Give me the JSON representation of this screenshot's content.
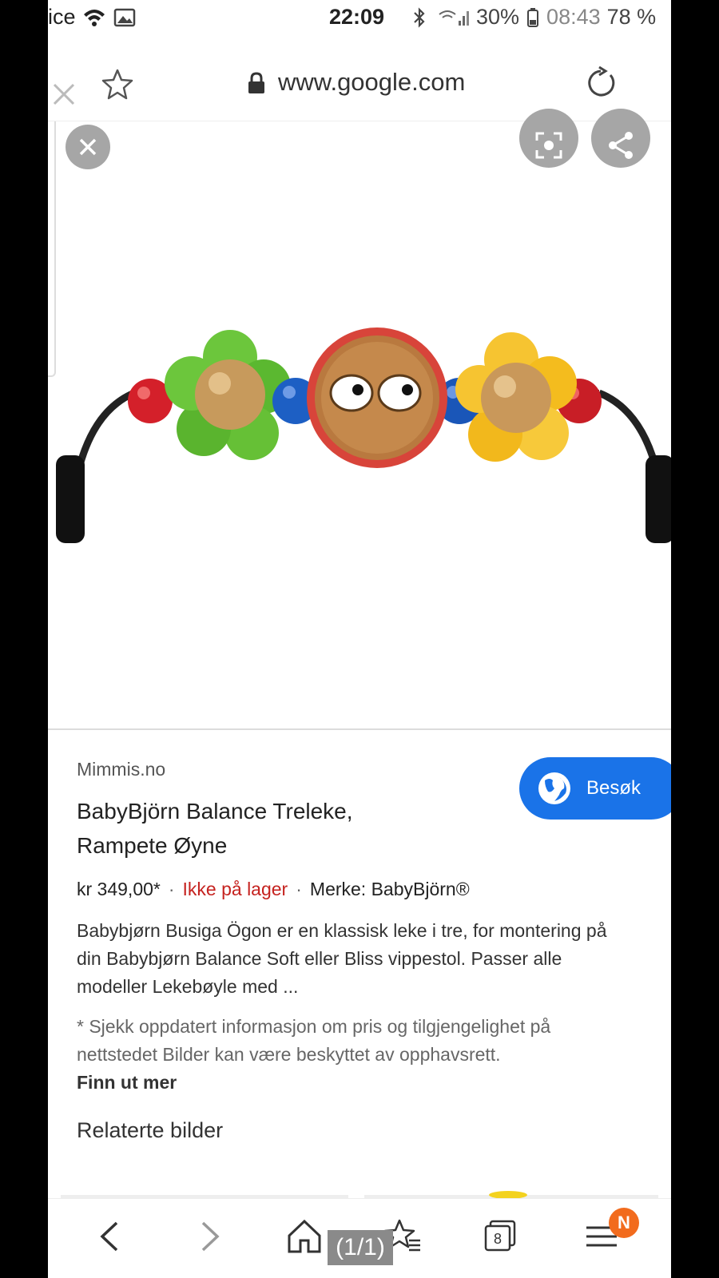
{
  "status_bar": {
    "carrier": "ice",
    "time": "22:09",
    "battery": "30%",
    "overlay_time": "08:43",
    "overlay_battery": "78 %",
    "icons": [
      "wifi-icon",
      "image-notification-icon",
      "mail-notification-icon",
      "bluetooth-icon",
      "signal-icon",
      "battery-icon",
      "lock-rotation-icon"
    ]
  },
  "browser": {
    "url": "www.google.com",
    "icons": [
      "close-tab-icon",
      "bookmark-star-icon",
      "lock-icon",
      "reload-icon"
    ]
  },
  "viewer": {
    "icons": [
      "close-icon",
      "lens-icon",
      "share-icon"
    ]
  },
  "product": {
    "source": "Mimmis.no",
    "title": "BabyBjörn Balance Treleke, Rampete Øyne",
    "price": "kr 349,00*",
    "stock": "Ikke på lager",
    "brand": "Merke: BabyBjörn®",
    "description": "Babybjørn Busiga Ögon er en klassisk leke i tre, for montering på din Babybjørn Balance Soft eller Bliss vippestol. Passer alle modeller Lekebøyle med ...",
    "disclaimer": "* Sjekk oppdatert informasjon om pris og tilgjengelighet på nettstedet Bilder kan være beskyttet av opphavsrett.",
    "learn_more": "Finn ut mer",
    "visit_label": "Besøk",
    "separator": "·"
  },
  "related_heading": "Relaterte bilder",
  "bottom_nav": {
    "page_indicator": "(1/1)",
    "tabs_count": "8",
    "menu_badge": "N",
    "icons": [
      "back-icon",
      "forward-icon",
      "home-icon",
      "bookmarks-icon",
      "tabs-icon",
      "menu-icon"
    ]
  },
  "colors": {
    "accent": "#1a73e8",
    "stock_warning": "#c5221f",
    "badge": "#f26b1d"
  }
}
